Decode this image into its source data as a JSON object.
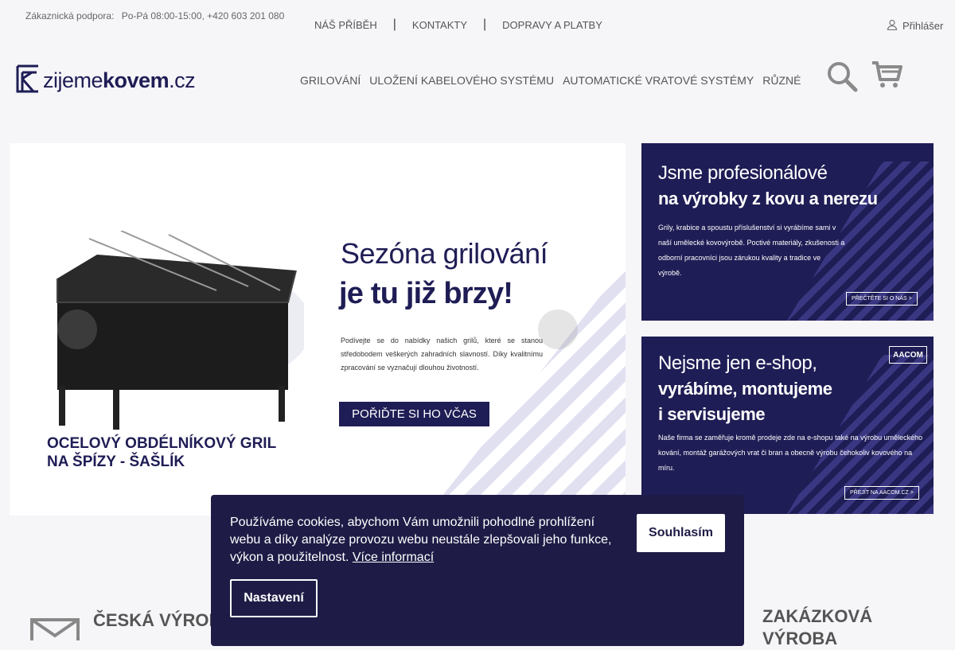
{
  "topbar": {
    "support_label": "Zákaznická podpora:",
    "support_hours": "Po-Pá 08:00-15:00, +420 603 201 080",
    "links": [
      "NÁŠ PŘÍBĚH",
      "KONTAKTY",
      "DOPRAVY A PLATBY"
    ],
    "separator": "|",
    "more_glyph": "",
    "login_label": "Přihlášer"
  },
  "logo": {
    "part1": "zijeme",
    "part2": "kovem",
    "part3": ".cz"
  },
  "nav": [
    "GRILOVÁNÍ",
    "ULOŽENÍ KABELOVÉHO SYSTÉMU",
    "AUTOMATICKÉ VRATOVÉ SYSTÉMY",
    "RŮZNÉ"
  ],
  "icons": {
    "search": "search-icon",
    "cart": "cart-icon",
    "user": "user-icon",
    "envelope": "envelope-icon"
  },
  "hero": {
    "title": "Sezóna grilování",
    "subtitle": "je tu již brzy!",
    "description": "Podívejte se do nabídky našich grilů, které se stanou středobodem veškerých zahradních slavností. Díky kvalitnímu zpracování se vyznačují dlouhou životností.",
    "cta": "POŘIĎTE SI HO VČAS",
    "product_line1": "OCELOVÝ OBDÉLNÍKOVÝ GRIL",
    "product_line2": "NA ŠPÍZY - ŠAŠLÍK",
    "prev_glyph": "",
    "next_glyph": ""
  },
  "banner1": {
    "line1": "Jsme profesionálové",
    "line2": "na výrobky z kovu a nerezu",
    "body": "Grily, krabice a spoustu příslušenství si vyrábíme sami v naší umělecké kovovýrobě. Poctivé materiály, zkušenosti a odborní pracovníci jsou zárukou kvality a tradice ve výrobě.",
    "button": "PŘEČTĚTE SI O NÁS >"
  },
  "banner2": {
    "badge": "AACOM",
    "line1": "Nejsme jen e-shop,",
    "line2": "vyrábíme, montujeme",
    "line3": "i servisujeme",
    "body": "Naše firma se zaměřuje kromě prodeje zde na e-shopu také na výrobu uměleckého kování, montáž garážových vrat či bran a obecně výrobu čehokoliv kovového na míru.",
    "button": "PŘEJÍT NA AACOM.CZ >"
  },
  "cookie": {
    "message": "Používáme cookies, abychom Vám umožnili pohodlné prohlížení webu a díky analýze provozu webu neustále zlepšovali jeho funkce, výkon a použitelnost.",
    "more_link": "Více informací",
    "agree": "Souhlasím",
    "settings": "Nastavení"
  },
  "features": {
    "left": "ČESKÁ VÝROBA",
    "right": "ZAKÁZKOVÁ VÝROBA"
  },
  "colors": {
    "brand": "#1f1d55",
    "cookie_bg": "#1e1c46",
    "page_bg": "#f6f6f9"
  }
}
